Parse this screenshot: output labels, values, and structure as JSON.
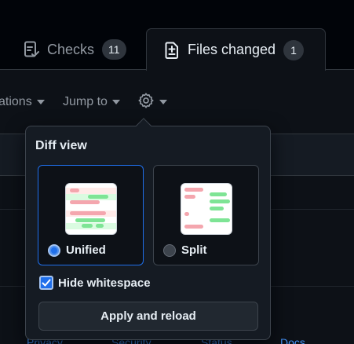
{
  "tabs": [
    {
      "label": "Checks",
      "count": "11",
      "icon": "checklist-icon"
    },
    {
      "label": "Files changed",
      "count": "1",
      "icon": "file-diff-icon"
    }
  ],
  "toolbar": {
    "annotations_label": "ations",
    "jump_label": "Jump to",
    "settings_icon": "gear-icon"
  },
  "popover": {
    "title": "Diff view",
    "options": [
      {
        "label": "Unified",
        "selected": true
      },
      {
        "label": "Split",
        "selected": false
      }
    ],
    "hide_whitespace_label": "Hide whitespace",
    "hide_whitespace_checked": true,
    "apply_label": "Apply and reload"
  },
  "footer": {
    "links": [
      "Privacy",
      "Security",
      "Status",
      "Docs"
    ]
  },
  "colors": {
    "accent": "#1f6feb",
    "background": "#0d1117",
    "deletion": "#f4a6ae",
    "addition": "#7ee495"
  }
}
